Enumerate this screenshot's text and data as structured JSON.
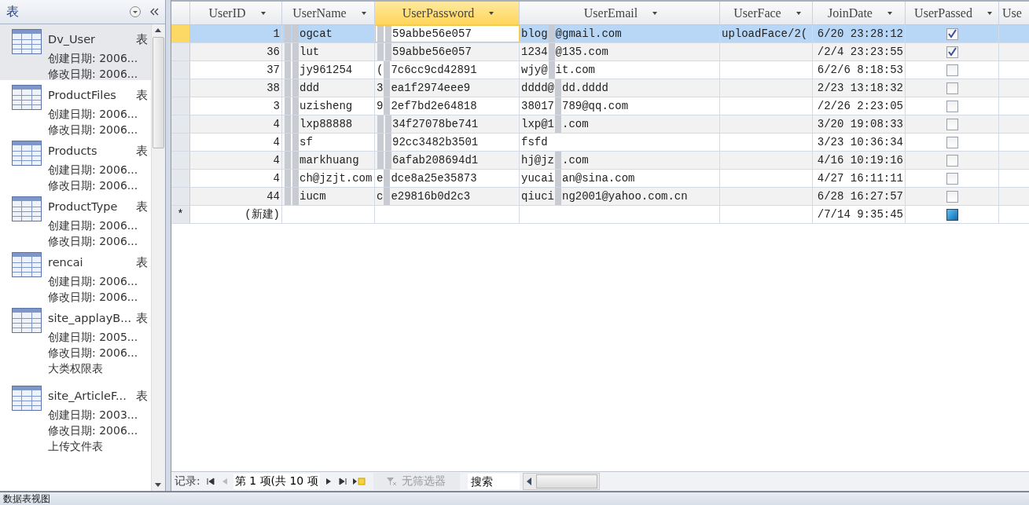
{
  "nav_pane": {
    "title": "表",
    "items": [
      {
        "name": "Dv_User",
        "type": "表",
        "lines": [
          "创建日期: 2006...",
          "修改日期: 2006..."
        ],
        "selected": true
      },
      {
        "name": "ProductFiles",
        "type": "表",
        "lines": [
          "创建日期: 2006...",
          "修改日期: 2006..."
        ],
        "selected": false
      },
      {
        "name": "Products",
        "type": "表",
        "lines": [
          "创建日期: 2006...",
          "修改日期: 2006..."
        ],
        "selected": false
      },
      {
        "name": "ProductType",
        "type": "表",
        "lines": [
          "创建日期: 2006...",
          "修改日期: 2006..."
        ],
        "selected": false
      },
      {
        "name": "rencai",
        "type": "表",
        "lines": [
          "创建日期: 2006...",
          "修改日期: 2006..."
        ],
        "selected": false
      },
      {
        "name": "site_applayB...",
        "type": "表",
        "lines": [
          "创建日期: 2005...",
          "修改日期: 2006...",
          "大类权限表"
        ],
        "selected": false
      },
      {
        "name": "site_ArticleF...",
        "type": "表",
        "lines": [
          "创建日期: 2003...",
          "修改日期: 2006...",
          "上传文件表"
        ],
        "selected": false
      }
    ]
  },
  "datasheet": {
    "columns": [
      {
        "label": "UserID",
        "selected": false
      },
      {
        "label": "UserName",
        "selected": false
      },
      {
        "label": "UserPassword",
        "selected": true
      },
      {
        "label": "UserEmail",
        "selected": false
      },
      {
        "label": "UserFace",
        "selected": false
      },
      {
        "label": "JoinDate",
        "selected": false
      },
      {
        "label": "UserPassed",
        "selected": false
      },
      {
        "label": "Use",
        "selected": false
      }
    ],
    "rows": [
      {
        "kind": "record",
        "selected": true,
        "cells": [
          "1",
          [
            "",
            "ogcat"
          ],
          [
            "",
            "59abbe56e057"
          ],
          [
            "blog",
            "@gmail.com"
          ],
          "uploadFace/2(",
          "6/20 23:28:12"
        ],
        "passed": true
      },
      {
        "kind": "record",
        "selected": false,
        "cells": [
          "36",
          [
            "",
            "lut"
          ],
          [
            "",
            "59abbe56e057"
          ],
          [
            "1234",
            "@135.com"
          ],
          null,
          "/2/4 23:23:55"
        ],
        "passed": true
      },
      {
        "kind": "record",
        "selected": false,
        "cells": [
          "37",
          [
            "",
            "jy961254"
          ],
          [
            "(",
            "7c6cc9cd42891"
          ],
          [
            "wjy@",
            "it.com"
          ],
          null,
          "6/2/6 8:18:53"
        ],
        "passed": false
      },
      {
        "kind": "record",
        "selected": false,
        "cells": [
          "38",
          [
            "",
            "ddd"
          ],
          [
            "3",
            "ea1f2974eee9"
          ],
          [
            "dddd@",
            "dd.dddd"
          ],
          null,
          "2/23 13:18:32"
        ],
        "passed": false
      },
      {
        "kind": "record",
        "selected": false,
        "cells": [
          "3",
          [
            "",
            "uzisheng"
          ],
          [
            "9",
            "2ef7bd2e64818"
          ],
          [
            "38017",
            "789@qq.com"
          ],
          null,
          "/2/26 2:23:05"
        ],
        "passed": false
      },
      {
        "kind": "record",
        "selected": false,
        "cells": [
          "4",
          [
            "",
            "lxp88888"
          ],
          [
            "",
            "34f27078be741"
          ],
          [
            "lxp@1",
            ".com"
          ],
          null,
          "3/20 19:08:33"
        ],
        "passed": false
      },
      {
        "kind": "record",
        "selected": false,
        "cells": [
          "4",
          [
            "",
            "sf"
          ],
          [
            "",
            "92cc3482b3501"
          ],
          [
            "fsfd"
          ],
          null,
          "3/23 10:36:34"
        ],
        "passed": false
      },
      {
        "kind": "record",
        "selected": false,
        "cells": [
          "4",
          [
            "",
            "markhuang"
          ],
          [
            "",
            "6afab208694d1"
          ],
          [
            "hj@jz",
            ".com"
          ],
          null,
          "4/16 10:19:16"
        ],
        "passed": false
      },
      {
        "kind": "record",
        "selected": false,
        "cells": [
          "4",
          [
            "",
            "ch@jzjt.com"
          ],
          [
            "e",
            "dce8a25e35873"
          ],
          [
            "yucai",
            "an@sina.com"
          ],
          null,
          "4/27 16:11:11"
        ],
        "passed": false
      },
      {
        "kind": "record",
        "selected": false,
        "cells": [
          "44",
          [
            "",
            "iucm"
          ],
          [
            "c",
            "e29816b0d2c3"
          ],
          [
            "qiuci",
            "ng2001@yahoo.com.cn"
          ],
          null,
          "6/28 16:27:57"
        ],
        "passed": false
      },
      {
        "kind": "new",
        "selected": false,
        "marker": "*",
        "cells": [
          "(新建)",
          null,
          null,
          null,
          null,
          "/7/14 9:35:45"
        ],
        "passed": false
      }
    ]
  },
  "record_nav": {
    "label": "记录:",
    "position": "第 1 项(共 10 项",
    "filter": "无筛选器",
    "search": {
      "placeholder": "搜索"
    }
  },
  "status_bar": {
    "text": "数据表视图"
  }
}
